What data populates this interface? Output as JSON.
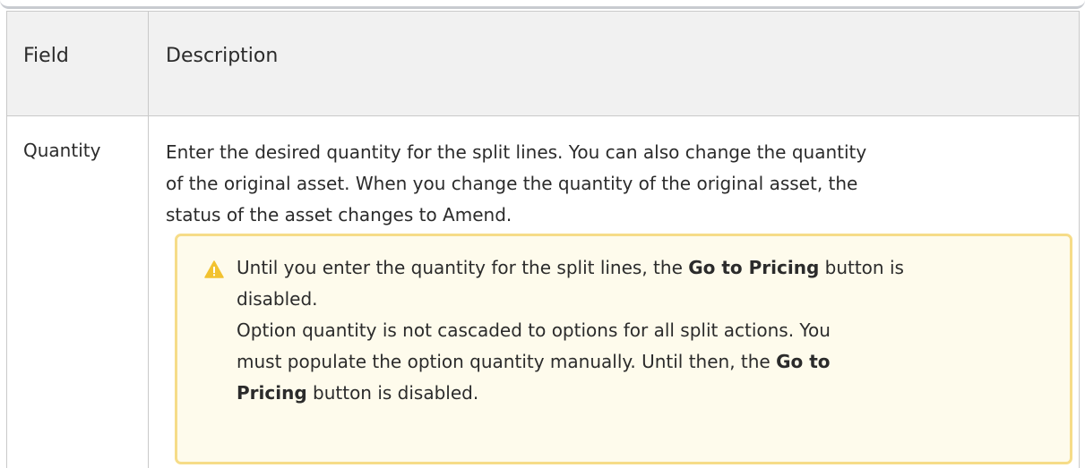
{
  "table": {
    "header_field": "Field",
    "header_description": "Description"
  },
  "row": {
    "field": "Quantity",
    "description_line1": "Enter the desired quantity for the split lines. You can also change the quantity",
    "description_line2": "of the original asset. When you change the quantity of the original asset, the",
    "description_line3": "status of the asset changes to Amend."
  },
  "note": {
    "icon": "warning-triangle-icon",
    "color_icon": "#f2c230",
    "p1_before": "Until you enter the quantity for the split lines, the ",
    "p1_bold": "Go to Pricing",
    "p1_after": " button is",
    "p1_line2": "disabled.",
    "p2_line1": "Option quantity is not cascaded to options for all split actions. You",
    "p2_line2_before": "must populate the option quantity manually. Until then, the ",
    "p2_bold1": "Go to",
    "p2_bold2": "Pricing",
    "p2_after": " button is disabled."
  }
}
